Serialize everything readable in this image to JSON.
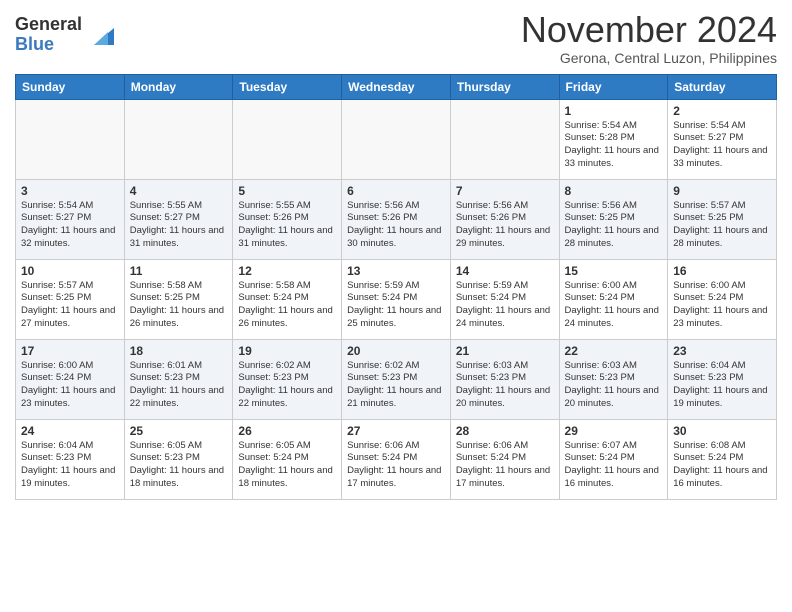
{
  "header": {
    "logo_general": "General",
    "logo_blue": "Blue",
    "month_title": "November 2024",
    "location": "Gerona, Central Luzon, Philippines"
  },
  "weekdays": [
    "Sunday",
    "Monday",
    "Tuesday",
    "Wednesday",
    "Thursday",
    "Friday",
    "Saturday"
  ],
  "weeks": [
    [
      {
        "day": "",
        "info": ""
      },
      {
        "day": "",
        "info": ""
      },
      {
        "day": "",
        "info": ""
      },
      {
        "day": "",
        "info": ""
      },
      {
        "day": "",
        "info": ""
      },
      {
        "day": "1",
        "info": "Sunrise: 5:54 AM\nSunset: 5:28 PM\nDaylight: 11 hours\nand 33 minutes."
      },
      {
        "day": "2",
        "info": "Sunrise: 5:54 AM\nSunset: 5:27 PM\nDaylight: 11 hours\nand 33 minutes."
      }
    ],
    [
      {
        "day": "3",
        "info": "Sunrise: 5:54 AM\nSunset: 5:27 PM\nDaylight: 11 hours\nand 32 minutes."
      },
      {
        "day": "4",
        "info": "Sunrise: 5:55 AM\nSunset: 5:27 PM\nDaylight: 11 hours\nand 31 minutes."
      },
      {
        "day": "5",
        "info": "Sunrise: 5:55 AM\nSunset: 5:26 PM\nDaylight: 11 hours\nand 31 minutes."
      },
      {
        "day": "6",
        "info": "Sunrise: 5:56 AM\nSunset: 5:26 PM\nDaylight: 11 hours\nand 30 minutes."
      },
      {
        "day": "7",
        "info": "Sunrise: 5:56 AM\nSunset: 5:26 PM\nDaylight: 11 hours\nand 29 minutes."
      },
      {
        "day": "8",
        "info": "Sunrise: 5:56 AM\nSunset: 5:25 PM\nDaylight: 11 hours\nand 28 minutes."
      },
      {
        "day": "9",
        "info": "Sunrise: 5:57 AM\nSunset: 5:25 PM\nDaylight: 11 hours\nand 28 minutes."
      }
    ],
    [
      {
        "day": "10",
        "info": "Sunrise: 5:57 AM\nSunset: 5:25 PM\nDaylight: 11 hours\nand 27 minutes."
      },
      {
        "day": "11",
        "info": "Sunrise: 5:58 AM\nSunset: 5:25 PM\nDaylight: 11 hours\nand 26 minutes."
      },
      {
        "day": "12",
        "info": "Sunrise: 5:58 AM\nSunset: 5:24 PM\nDaylight: 11 hours\nand 26 minutes."
      },
      {
        "day": "13",
        "info": "Sunrise: 5:59 AM\nSunset: 5:24 PM\nDaylight: 11 hours\nand 25 minutes."
      },
      {
        "day": "14",
        "info": "Sunrise: 5:59 AM\nSunset: 5:24 PM\nDaylight: 11 hours\nand 24 minutes."
      },
      {
        "day": "15",
        "info": "Sunrise: 6:00 AM\nSunset: 5:24 PM\nDaylight: 11 hours\nand 24 minutes."
      },
      {
        "day": "16",
        "info": "Sunrise: 6:00 AM\nSunset: 5:24 PM\nDaylight: 11 hours\nand 23 minutes."
      }
    ],
    [
      {
        "day": "17",
        "info": "Sunrise: 6:00 AM\nSunset: 5:24 PM\nDaylight: 11 hours\nand 23 minutes."
      },
      {
        "day": "18",
        "info": "Sunrise: 6:01 AM\nSunset: 5:23 PM\nDaylight: 11 hours\nand 22 minutes."
      },
      {
        "day": "19",
        "info": "Sunrise: 6:02 AM\nSunset: 5:23 PM\nDaylight: 11 hours\nand 22 minutes."
      },
      {
        "day": "20",
        "info": "Sunrise: 6:02 AM\nSunset: 5:23 PM\nDaylight: 11 hours\nand 21 minutes."
      },
      {
        "day": "21",
        "info": "Sunrise: 6:03 AM\nSunset: 5:23 PM\nDaylight: 11 hours\nand 20 minutes."
      },
      {
        "day": "22",
        "info": "Sunrise: 6:03 AM\nSunset: 5:23 PM\nDaylight: 11 hours\nand 20 minutes."
      },
      {
        "day": "23",
        "info": "Sunrise: 6:04 AM\nSunset: 5:23 PM\nDaylight: 11 hours\nand 19 minutes."
      }
    ],
    [
      {
        "day": "24",
        "info": "Sunrise: 6:04 AM\nSunset: 5:23 PM\nDaylight: 11 hours\nand 19 minutes."
      },
      {
        "day": "25",
        "info": "Sunrise: 6:05 AM\nSunset: 5:23 PM\nDaylight: 11 hours\nand 18 minutes."
      },
      {
        "day": "26",
        "info": "Sunrise: 6:05 AM\nSunset: 5:24 PM\nDaylight: 11 hours\nand 18 minutes."
      },
      {
        "day": "27",
        "info": "Sunrise: 6:06 AM\nSunset: 5:24 PM\nDaylight: 11 hours\nand 17 minutes."
      },
      {
        "day": "28",
        "info": "Sunrise: 6:06 AM\nSunset: 5:24 PM\nDaylight: 11 hours\nand 17 minutes."
      },
      {
        "day": "29",
        "info": "Sunrise: 6:07 AM\nSunset: 5:24 PM\nDaylight: 11 hours\nand 16 minutes."
      },
      {
        "day": "30",
        "info": "Sunrise: 6:08 AM\nSunset: 5:24 PM\nDaylight: 11 hours\nand 16 minutes."
      }
    ]
  ]
}
